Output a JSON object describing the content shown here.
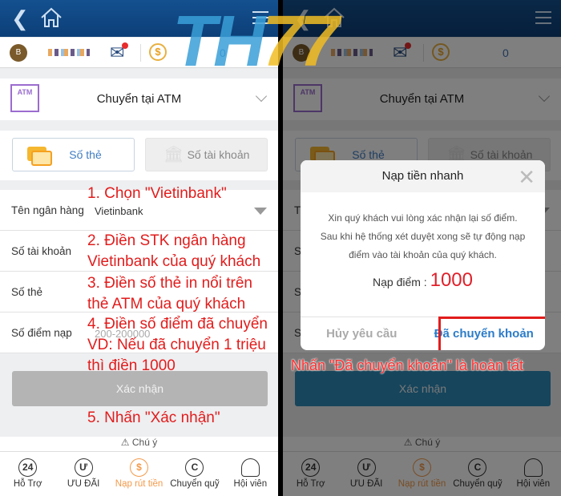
{
  "header": {
    "back_icon": "chevron-left",
    "home_icon": "home",
    "menu_icon": "hamburger"
  },
  "info": {
    "avatar": "B",
    "balance": "0"
  },
  "method": {
    "atm_icon": "ATM",
    "title": "Chuyển tại ATM"
  },
  "tabs": [
    {
      "label": "Số thẻ"
    },
    {
      "label": "Số tài khoản"
    }
  ],
  "form": {
    "bank_label": "Tên ngân hàng",
    "bank_value": "Vietinbank",
    "account_label": "Số tài khoản",
    "card_label": "Số thẻ",
    "points_label": "Số điểm nạp",
    "points_placeholder": "200-200000"
  },
  "confirm_label": "Xác nhận",
  "note": "⚠ Chú ý",
  "nav": [
    {
      "label": "Hỗ Trợ",
      "icon": "24"
    },
    {
      "label": "ƯU ĐÃI",
      "icon": "Ư"
    },
    {
      "label": "Nạp rút tiền",
      "icon": "$"
    },
    {
      "label": "Chuyển quỹ",
      "icon": "C"
    },
    {
      "label": "Hội viên",
      "icon": "user"
    }
  ],
  "annotations": [
    "1. Chọn \"Vietinbank\"",
    "2. Điền STK ngân hàng",
    "Vietinbank của quý khách",
    "3. Điền số thẻ in nổi trên",
    "thẻ ATM của quý khách",
    "4. Điền số điểm đã chuyển",
    "VD: Nếu đã chuyển 1 triệu",
    "thì điền 1000",
    "5. Nhấn \"Xác nhận\""
  ],
  "modal": {
    "title": "Nạp tiền nhanh",
    "line1": "Xin quý khách vui lòng xác nhận lại số điểm.",
    "line2": "Sau khi hệ thống xét duyệt xong sẽ tự động nạp",
    "line3": "điểm vào tài khoản của quý khách.",
    "points_label": "Nạp điểm :",
    "points_value": "1000",
    "cancel": "Hủy yêu cầu",
    "ok": "Đã chuyển khoản"
  },
  "caption": "Nhấn \"Đã chuyển khoản\" là hoàn tất",
  "watermark": {
    "part1": "TH",
    "part2": "77"
  },
  "colors": {
    "header": "#0f4a8a",
    "accent": "#f39a4a",
    "annotation": "#e21c1c"
  }
}
